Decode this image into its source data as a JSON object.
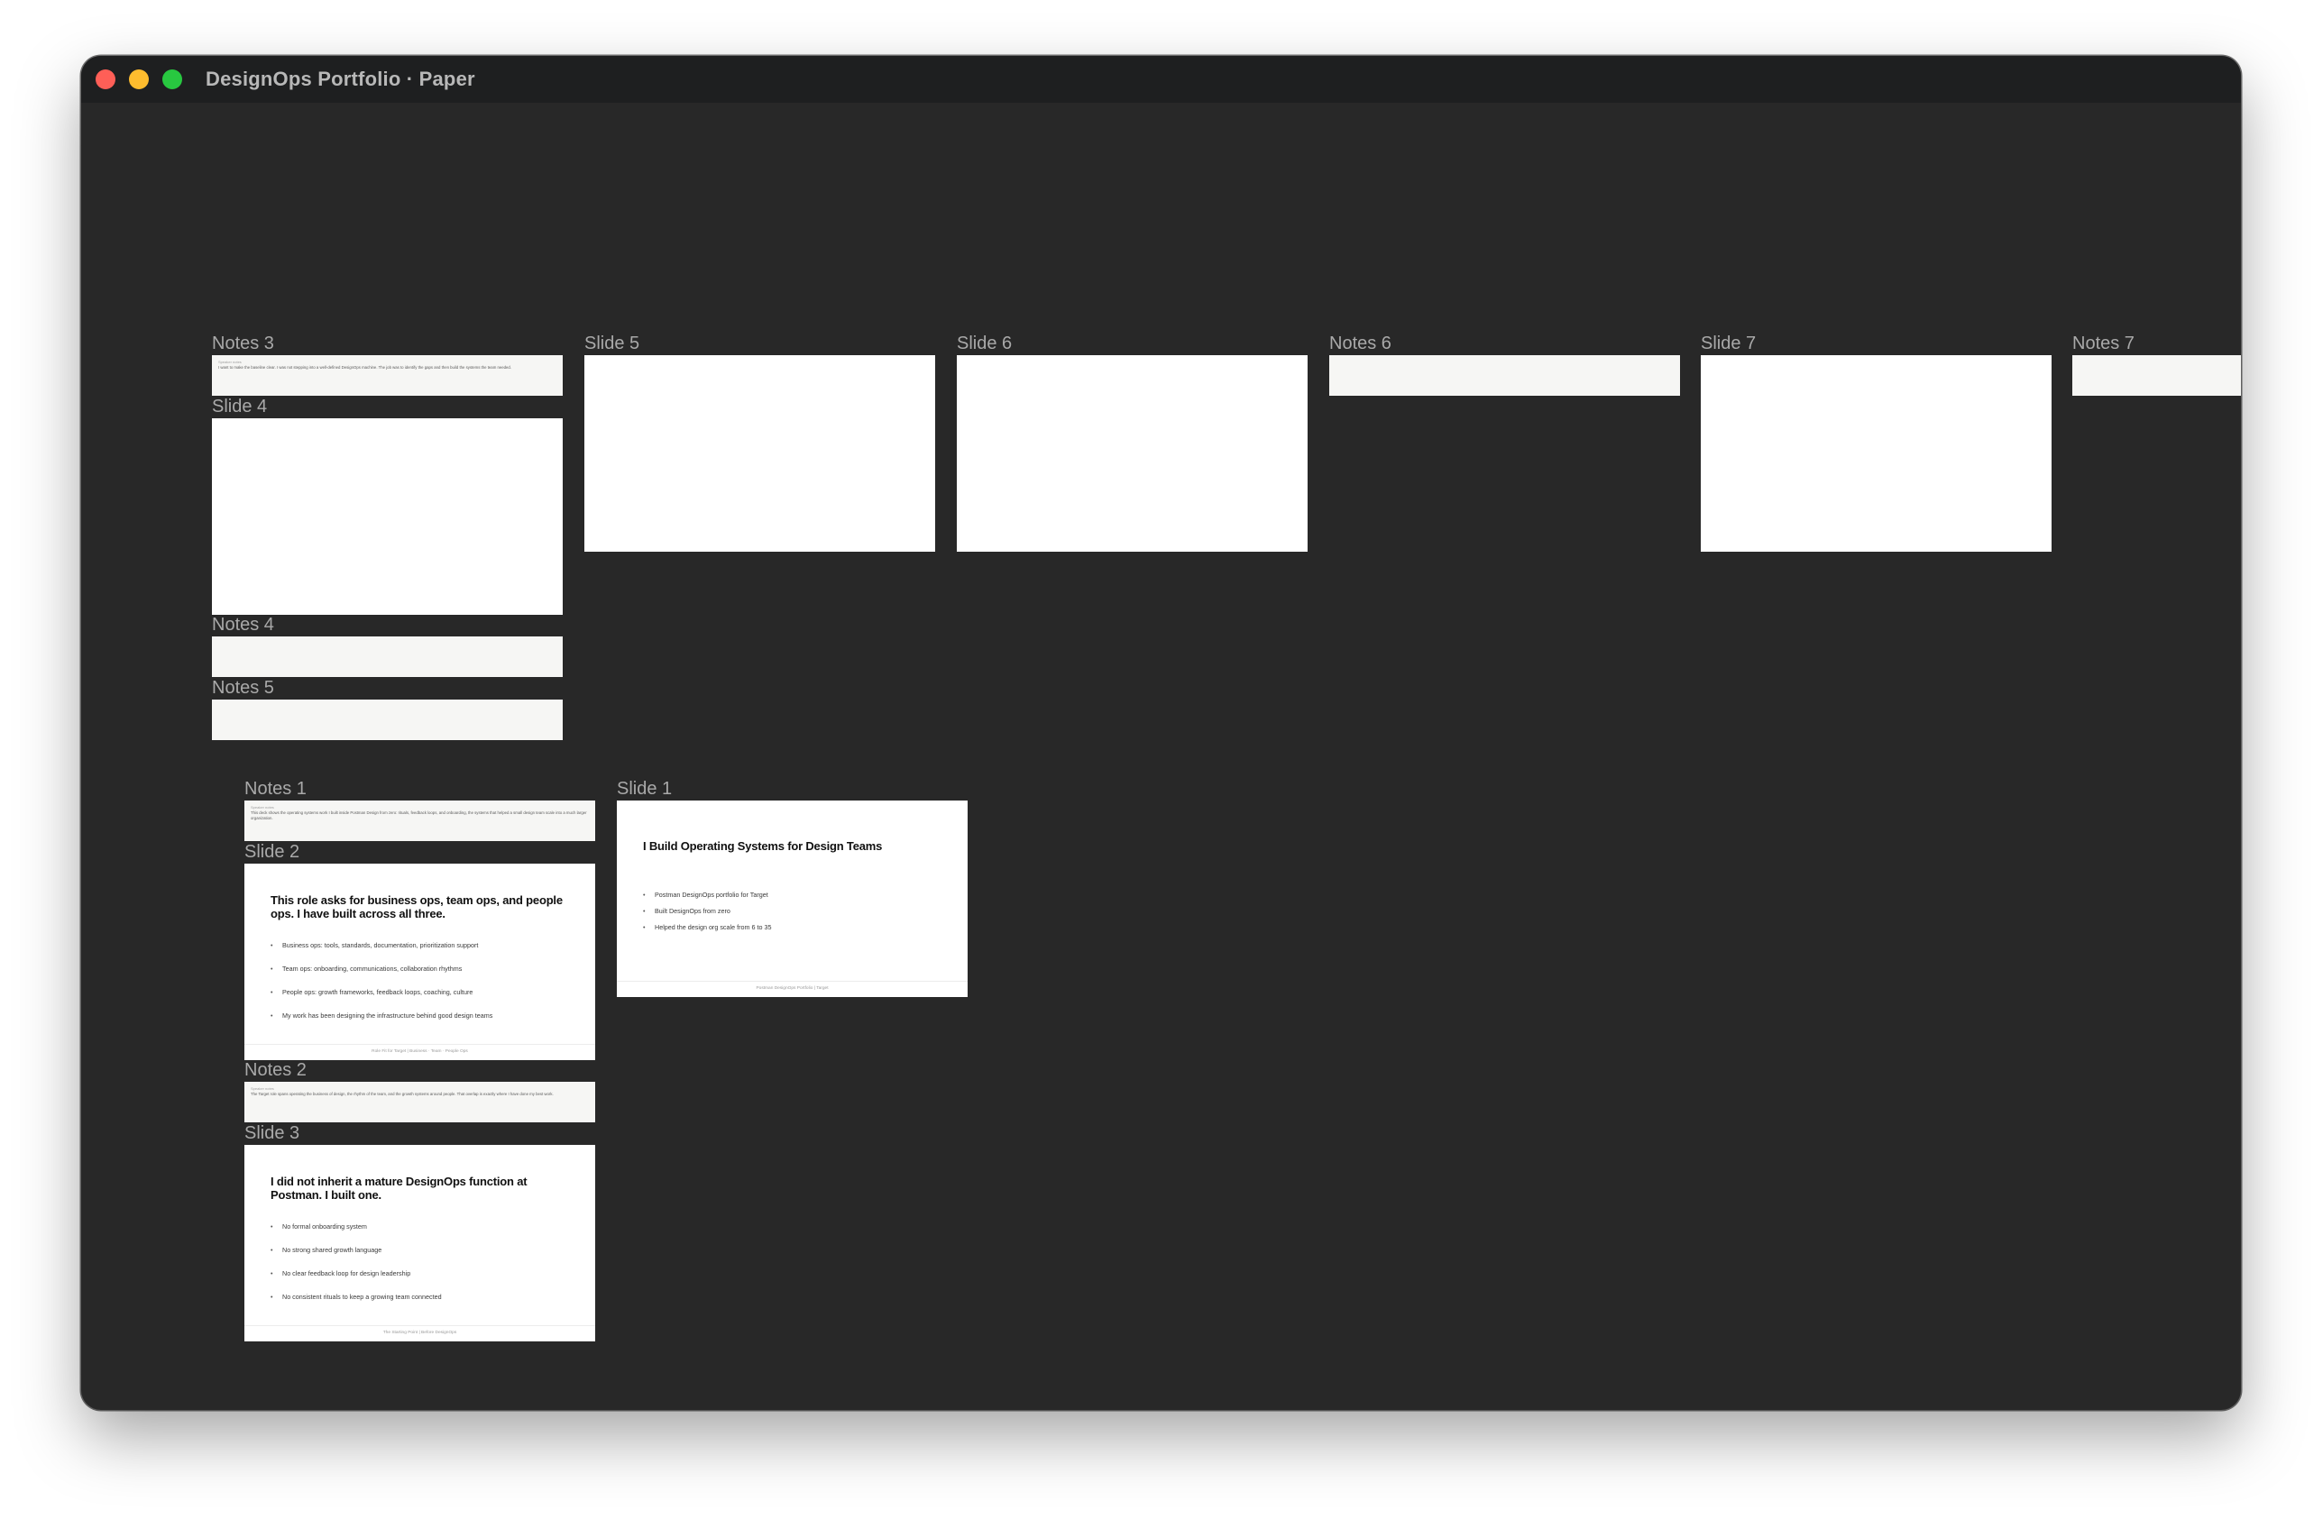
{
  "window": {
    "title": "DesignOps Portfolio · Paper"
  },
  "frames": {
    "notes3": {
      "label": "Notes 3",
      "header": "Speaker notes",
      "body": "I want to make the baseline clear. I was not stepping into a well-defined DesignOps machine. The job was to identify the gaps and then build the systems the team needed."
    },
    "slide4": {
      "label": "Slide 4"
    },
    "notes4": {
      "label": "Notes 4"
    },
    "notes5": {
      "label": "Notes 5"
    },
    "slide5": {
      "label": "Slide 5"
    },
    "slide6": {
      "label": "Slide 6"
    },
    "notes6": {
      "label": "Notes 6"
    },
    "slide7": {
      "label": "Slide 7"
    },
    "notes7": {
      "label": "Notes 7"
    },
    "notes1": {
      "label": "Notes 1",
      "header": "Speaker notes",
      "body": "This deck shows the operating systems work I built inside Postman Design from zero: rituals, feedback loops, and onboarding, the systems that helped a small design team scale into a much larger organization."
    },
    "slide1": {
      "label": "Slide 1",
      "title": "I Build Operating Systems for Design Teams",
      "bullets": [
        "Postman DesignOps portfolio for Target",
        "Built DesignOps from zero",
        "Helped the design org scale from 6 to 35"
      ],
      "footer": "Postman DesignOps Portfolio | Target"
    },
    "slide2": {
      "label": "Slide 2",
      "title": "This role asks for business ops, team ops, and people ops. I have built across all three.",
      "bullets": [
        "Business ops: tools, standards, documentation, prioritization support",
        "Team ops: onboarding, communications, collaboration rhythms",
        "People ops: growth frameworks, feedback loops, coaching, culture",
        "My work has been designing the infrastructure behind good design teams"
      ],
      "footer": "Role Fit for Target | Business · Team · People Ops"
    },
    "notes2": {
      "label": "Notes 2",
      "header": "Speaker notes",
      "body": "The Target role spans operating the business of design, the rhythm of the team, and the growth systems around people. That overlap is exactly where I have done my best work."
    },
    "slide3": {
      "label": "Slide 3",
      "title": "I did not inherit a mature DesignOps function at Postman. I built one.",
      "bullets": [
        "No formal onboarding system",
        "No strong shared growth language",
        "No clear feedback loop for design leadership",
        "No consistent rituals to keep a growing team connected"
      ],
      "footer": "The Starting Point | Before DesignOps"
    }
  }
}
